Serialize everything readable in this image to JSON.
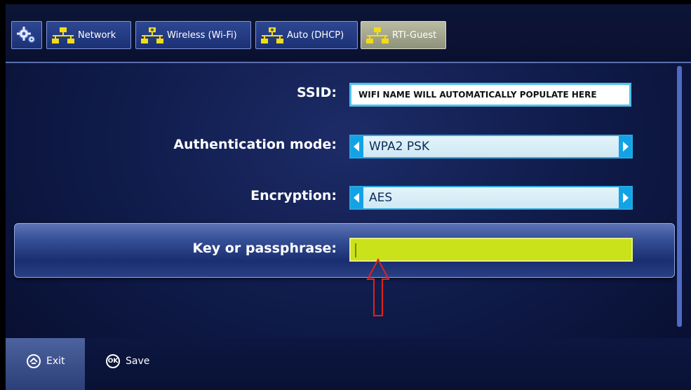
{
  "breadcrumbs": [
    {
      "label": "",
      "icon": "gear-icon"
    },
    {
      "label": "Network",
      "icon": "network-icon"
    },
    {
      "label": "Wireless (Wi-Fi)",
      "icon": "network-gear-icon"
    },
    {
      "label": "Auto (DHCP)",
      "icon": "network-gear-icon"
    },
    {
      "label": "RTI-Guest",
      "icon": "network-icon",
      "active": true
    }
  ],
  "form": {
    "ssid_label": "SSID:",
    "ssid_value": "WIFI NAME WILL AUTOMATICALLY POPULATE HERE",
    "auth_label": "Authentication mode:",
    "auth_value": "WPA2 PSK",
    "encryption_label": "Encryption:",
    "encryption_value": "AES",
    "key_label": "Key or passphrase:",
    "key_value": ""
  },
  "footer": {
    "exit_label": "Exit",
    "save_label": "Save",
    "save_icon_text": "OK"
  },
  "colors": {
    "accent": "#12a3e6",
    "key_field": "#c9e21a",
    "annotation_arrow": "#e0231c"
  }
}
